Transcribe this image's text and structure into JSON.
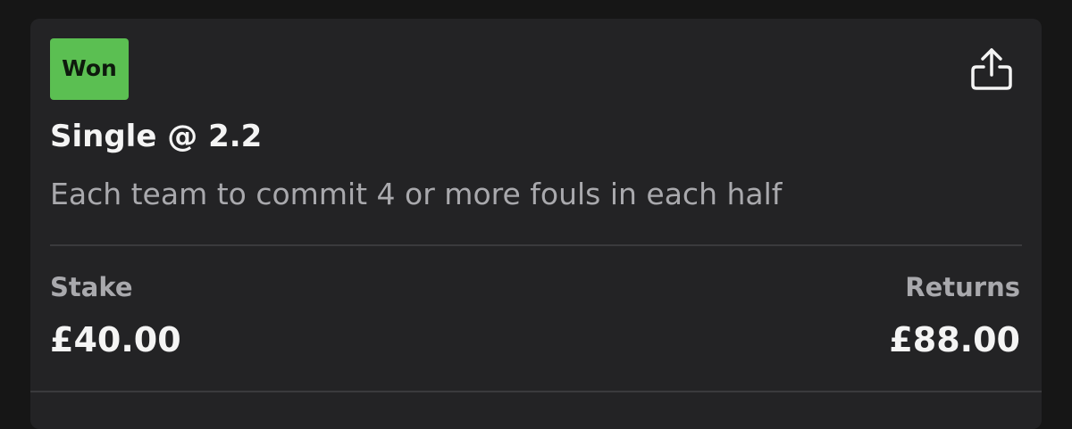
{
  "bet": {
    "status": "Won",
    "title": "Single @ 2.2",
    "description": "Each team to commit 4 or more fouls in each half"
  },
  "summary": {
    "stake_label": "Stake",
    "stake_value": "£40.00",
    "returns_label": "Returns",
    "returns_value": "£88.00"
  },
  "icons": {
    "share": "share-icon"
  },
  "colors": {
    "background": "#161616",
    "card": "#232325",
    "won_badge": "#5bbf52",
    "primary_text": "#f4f4f4",
    "secondary_text": "#a9a9ad"
  }
}
